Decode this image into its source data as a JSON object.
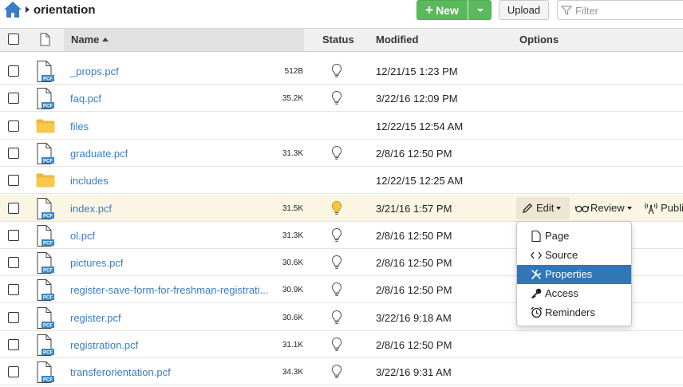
{
  "breadcrumb": {
    "current": "orientation"
  },
  "toolbar": {
    "new_label": "New",
    "upload_label": "Upload",
    "filter_placeholder": "Filter",
    "accent_color": "#5cb85c"
  },
  "table": {
    "headers": {
      "name": "Name",
      "status": "Status",
      "modified": "Modified",
      "options": "Options"
    },
    "rows": [
      {
        "name": "_props.pcf",
        "type": "pcf",
        "size": "512B",
        "status": "unlit",
        "modified": "12/21/15 1:23 PM"
      },
      {
        "name": "faq.pcf",
        "type": "pcf",
        "size": "35.2K",
        "status": "unlit",
        "modified": "3/22/16 12:09 PM"
      },
      {
        "name": "files",
        "type": "folder",
        "size": "",
        "status": "",
        "modified": "12/22/15 12:54 AM"
      },
      {
        "name": "graduate.pcf",
        "type": "pcf",
        "size": "31.3K",
        "status": "unlit",
        "modified": "2/8/16 12:50 PM"
      },
      {
        "name": "includes",
        "type": "folder",
        "size": "",
        "status": "",
        "modified": "12/22/15 12:25 AM"
      },
      {
        "name": "index.pcf",
        "type": "pcf",
        "size": "31.5K",
        "status": "lit",
        "modified": "3/21/16 1:57 PM"
      },
      {
        "name": "ol.pcf",
        "type": "pcf",
        "size": "31.3K",
        "status": "unlit",
        "modified": "2/8/16 12:50 PM"
      },
      {
        "name": "pictures.pcf",
        "type": "pcf",
        "size": "30.6K",
        "status": "unlit",
        "modified": "2/8/16 12:50 PM"
      },
      {
        "name": "register-save-form-for-freshman-registrati...",
        "type": "pcf",
        "size": "30.9K",
        "status": "unlit",
        "modified": "2/8/16 12:50 PM"
      },
      {
        "name": "register.pcf",
        "type": "pcf",
        "size": "30.6K",
        "status": "unlit",
        "modified": "3/22/16 9:18 AM"
      },
      {
        "name": "registration.pcf",
        "type": "pcf",
        "size": "31.1K",
        "status": "unlit",
        "modified": "2/8/16 12:50 PM"
      },
      {
        "name": "transferorientation.pcf",
        "type": "pcf",
        "size": "34.3K",
        "status": "unlit",
        "modified": "3/22/16 9:31 AM"
      }
    ]
  },
  "row_options": {
    "edit_label": "Edit",
    "review_label": "Review",
    "publish_label": "Publi"
  },
  "edit_menu": {
    "items": [
      {
        "label": "Page",
        "icon": "page-icon"
      },
      {
        "label": "Source",
        "icon": "code-icon"
      },
      {
        "label": "Properties",
        "icon": "wrench-icon",
        "active": true
      },
      {
        "label": "Access",
        "icon": "key-icon"
      },
      {
        "label": "Reminders",
        "icon": "alarm-clock-icon"
      }
    ],
    "active_color": "#3177b7"
  },
  "file_icon_tag": "PCF"
}
